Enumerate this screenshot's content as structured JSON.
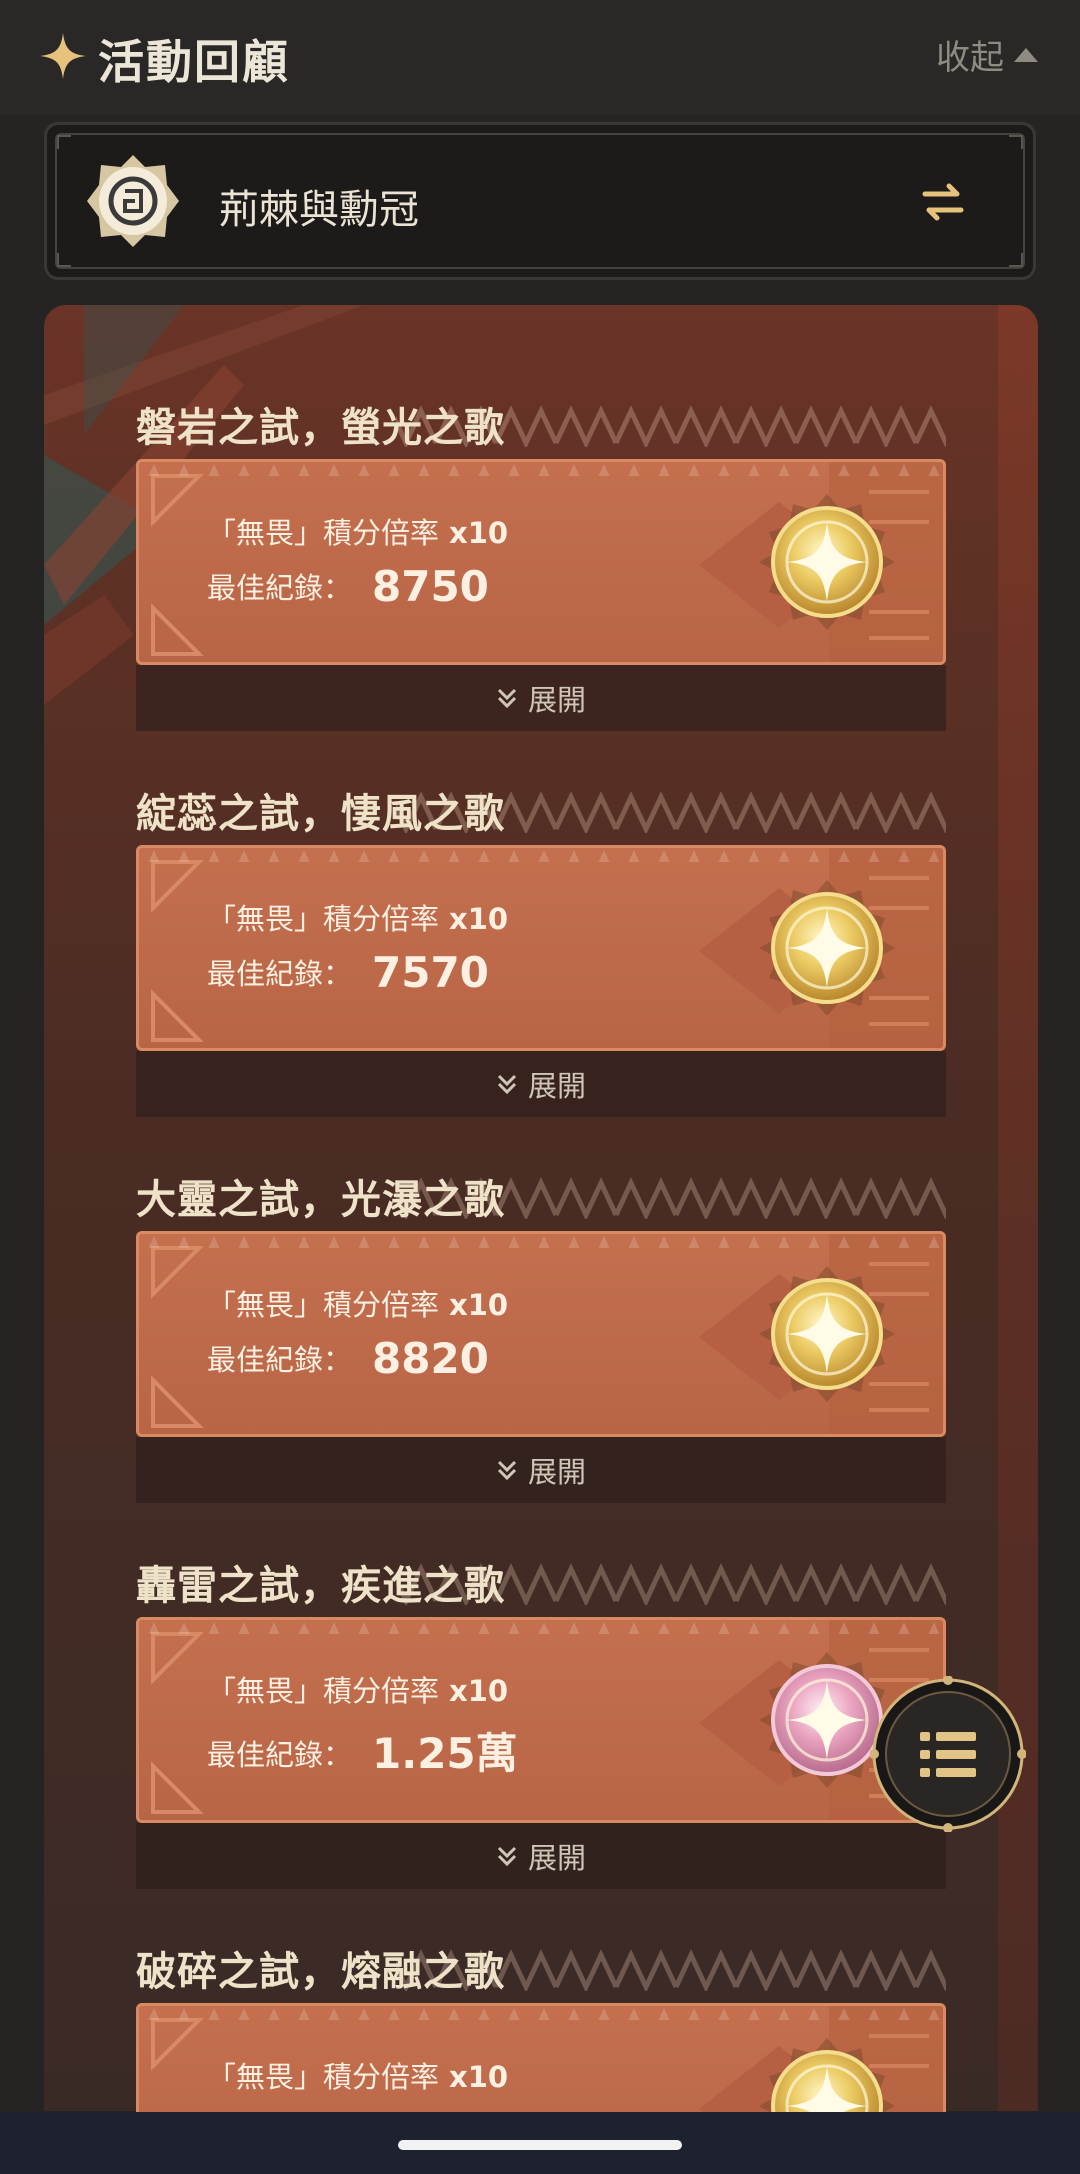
{
  "header": {
    "title": "活動回顧",
    "collapse_label": "收起"
  },
  "selector": {
    "event_name": "荊棘與勳冠"
  },
  "sections": [
    {
      "title": "磐岩之試，螢光之歌",
      "rate_label": "「無畏」積分倍率",
      "rate_value": "x10",
      "best_label": "最佳紀錄：",
      "best_value": "8750",
      "medal": "gold-medal-icon",
      "expand_label": "展開"
    },
    {
      "title": "綻蕊之試，悽風之歌",
      "rate_label": "「無畏」積分倍率",
      "rate_value": "x10",
      "best_label": "最佳紀錄：",
      "best_value": "7570",
      "medal": "gold-medal-icon",
      "expand_label": "展開"
    },
    {
      "title": "大靈之試，光瀑之歌",
      "rate_label": "「無畏」積分倍率",
      "rate_value": "x10",
      "best_label": "最佳紀錄：",
      "best_value": "8820",
      "medal": "gold-medal-icon",
      "expand_label": "展開"
    },
    {
      "title": "轟雷之試，疾進之歌",
      "rate_label": "「無畏」積分倍率",
      "rate_value": "x10",
      "best_label": "最佳紀錄：",
      "best_value": "1.25萬",
      "medal": "pink-medal-icon",
      "expand_label": "展開"
    },
    {
      "title": "破碎之試，熔融之歌",
      "rate_label": "「無畏」積分倍率",
      "rate_value": "x10",
      "best_label": "",
      "best_value": "",
      "medal": "gold-medal-icon",
      "expand_label": ""
    }
  ],
  "colors": {
    "card": "#c4704f",
    "gold": "#e8c35a",
    "pink": "#e89ab8",
    "background": "#262422"
  }
}
